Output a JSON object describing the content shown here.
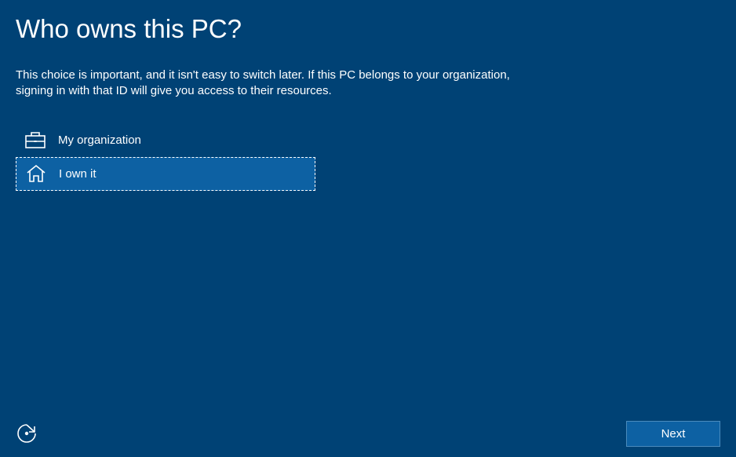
{
  "heading": "Who owns this PC?",
  "description": "This choice is important, and it isn't easy to switch later. If this PC belongs to your organization, signing in with that ID will give you access to their resources.",
  "options": [
    {
      "label": "My organization",
      "selected": false,
      "icon": "briefcase"
    },
    {
      "label": "I own it",
      "selected": true,
      "icon": "home"
    }
  ],
  "next_label": "Next"
}
